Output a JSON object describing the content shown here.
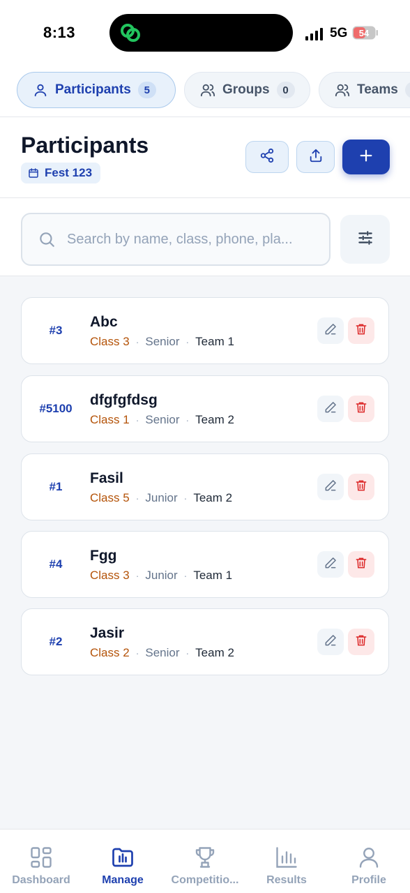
{
  "status_bar": {
    "time": "8:13",
    "network": "5G",
    "battery": "54"
  },
  "tabs": [
    {
      "label": "Participants",
      "count": "5",
      "icon": "user-icon",
      "active": true
    },
    {
      "label": "Groups",
      "count": "0",
      "icon": "users-icon",
      "active": false
    },
    {
      "label": "Teams",
      "count": "",
      "icon": "users-icon",
      "active": false
    }
  ],
  "header": {
    "title": "Participants",
    "fest_label": "Fest 123",
    "share_icon": "share-icon",
    "upload_icon": "upload-icon",
    "add_icon": "plus-icon"
  },
  "search": {
    "placeholder": "Search by name, class, phone, pla...",
    "value": ""
  },
  "participants": [
    {
      "number": "#3",
      "name": "Abc",
      "class": "Class 3",
      "level": "Senior",
      "team": "Team 1"
    },
    {
      "number": "#5100",
      "name": "dfgfgfdsg",
      "class": "Class 1",
      "level": "Senior",
      "team": "Team 2"
    },
    {
      "number": "#1",
      "name": "Fasil",
      "class": "Class 5",
      "level": "Junior",
      "team": "Team 2"
    },
    {
      "number": "#4",
      "name": "Fgg",
      "class": "Class 3",
      "level": "Junior",
      "team": "Team 1"
    },
    {
      "number": "#2",
      "name": "Jasir",
      "class": "Class 2",
      "level": "Senior",
      "team": "Team 2"
    }
  ],
  "meta_separator": "·",
  "bottom_nav": [
    {
      "label": "Dashboard",
      "icon": "dashboard-icon",
      "active": false
    },
    {
      "label": "Manage",
      "icon": "folder-icon",
      "active": true
    },
    {
      "label": "Competitio...",
      "icon": "trophy-icon",
      "active": false
    },
    {
      "label": "Results",
      "icon": "bar-chart-icon",
      "active": false
    },
    {
      "label": "Profile",
      "icon": "user-icon",
      "active": false
    }
  ],
  "colors": {
    "accent": "#1e40af",
    "class_text": "#b45309",
    "delete": "#dc2626",
    "background": "#f4f6f9"
  }
}
